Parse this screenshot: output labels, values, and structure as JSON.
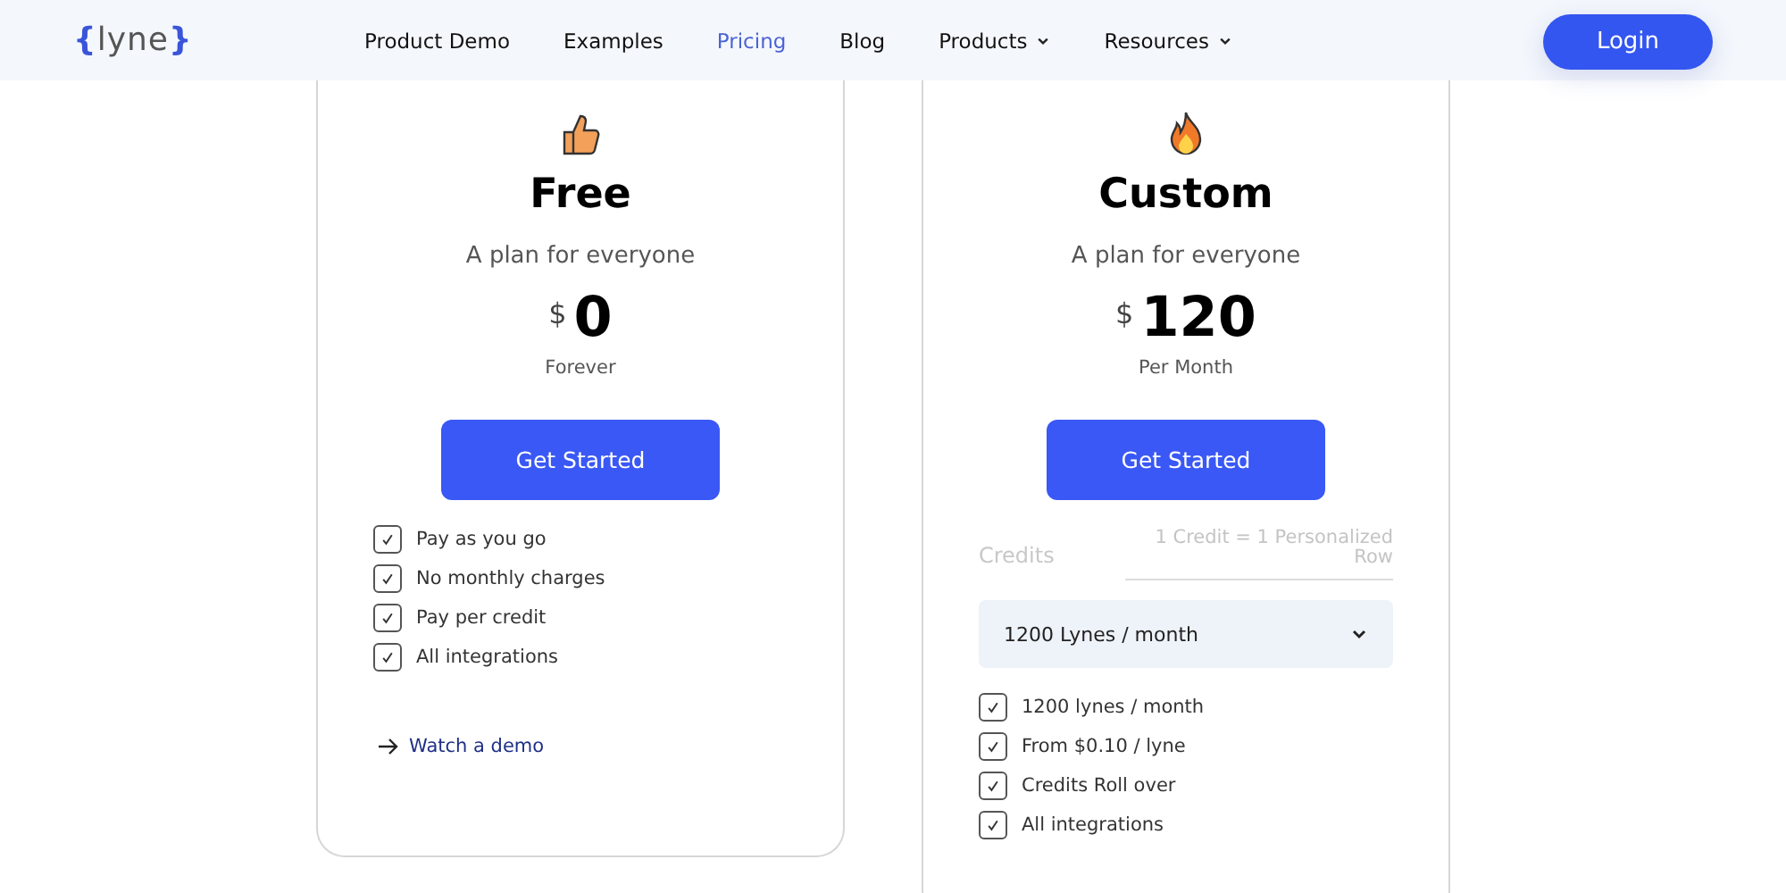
{
  "header": {
    "logo": {
      "open": "{",
      "name": "lyne",
      "close": "}"
    },
    "nav": [
      {
        "label": "Product Demo",
        "selected": false,
        "dropdown": false
      },
      {
        "label": "Examples",
        "selected": false,
        "dropdown": false
      },
      {
        "label": "Pricing",
        "selected": true,
        "dropdown": false
      },
      {
        "label": "Blog",
        "selected": false,
        "dropdown": false
      },
      {
        "label": "Products",
        "selected": false,
        "dropdown": true
      },
      {
        "label": "Resources",
        "selected": false,
        "dropdown": true
      }
    ],
    "login": "Login"
  },
  "plans": [
    {
      "name": "Free",
      "tagline": "A plan for everyone",
      "currency": "$",
      "price": "0",
      "period": "Forever",
      "cta": "Get Started",
      "features": [
        {
          "label": "Pay as you go",
          "checked": true
        },
        {
          "label": "No monthly charges",
          "checked": true
        },
        {
          "label": "Pay per credit",
          "checked": true
        },
        {
          "label": "All integrations",
          "checked": true
        }
      ],
      "link": "Watch a demo"
    },
    {
      "name": "Custom",
      "tagline": "A plan for everyone",
      "currency": "$",
      "price": "120",
      "period": "Per Month",
      "cta": "Get Started",
      "credits": {
        "label": "Credits",
        "note": "1 Credit = 1 Personalized Row",
        "value": "1200 Lynes / month"
      },
      "features": [
        {
          "label": "1200 lynes / month",
          "checked": true
        },
        {
          "label": "From $0.10 / lyne",
          "checked": true
        },
        {
          "label": "Credits Roll over",
          "checked": true
        },
        {
          "label": "All integrations",
          "checked": true
        }
      ]
    }
  ]
}
